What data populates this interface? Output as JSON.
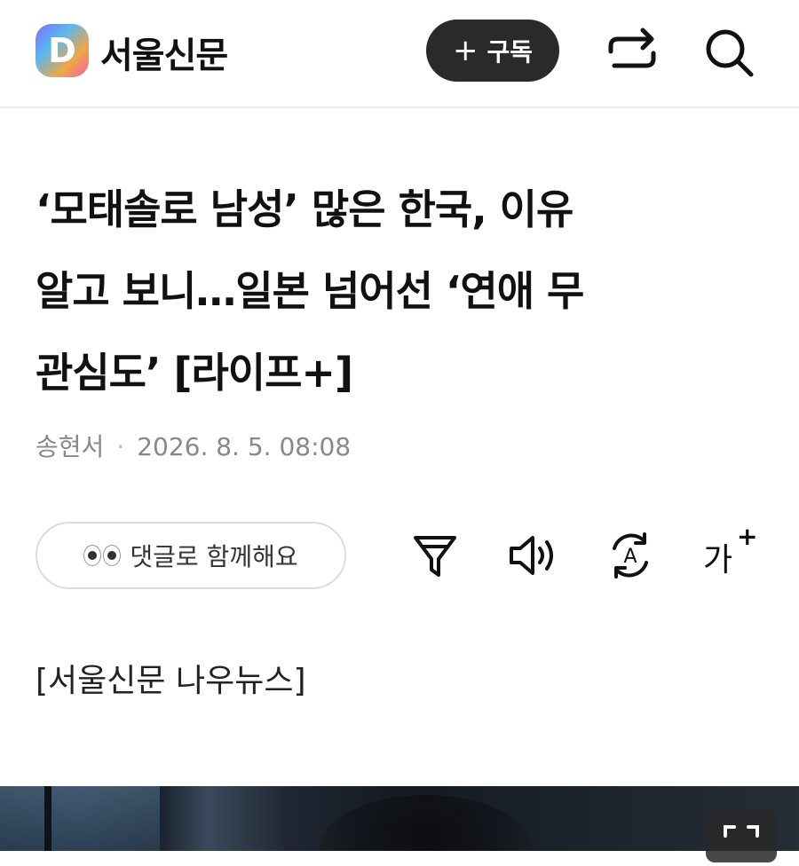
{
  "header": {
    "logo_letter": "D",
    "brand_name": "서울신문",
    "subscribe": {
      "plus": "+",
      "label": "구독"
    },
    "icons": [
      "share-icon",
      "search-icon"
    ]
  },
  "article": {
    "headline_lines": [
      "‘모태솔로 남성’ 많은 한국, 이유",
      "알고 보니…일본 넘어선 ‘연애 무",
      "관심도’ [라이프+]"
    ],
    "author": "송현서",
    "separator": "·",
    "datetime": "2026. 8. 5. 08:08",
    "source_line": "[서울신문 나우뉴스]"
  },
  "toolbar": {
    "comment_label": "댓글로 함께해요",
    "icons": [
      "filter-icon",
      "speaker-icon",
      "translate-icon",
      "font-size-icon"
    ],
    "font_size": {
      "label": "가",
      "sup": "+"
    }
  },
  "colors": {
    "subscribe_bg": "#2a2a2a",
    "byline": "#888888",
    "divider": "#ededed"
  }
}
